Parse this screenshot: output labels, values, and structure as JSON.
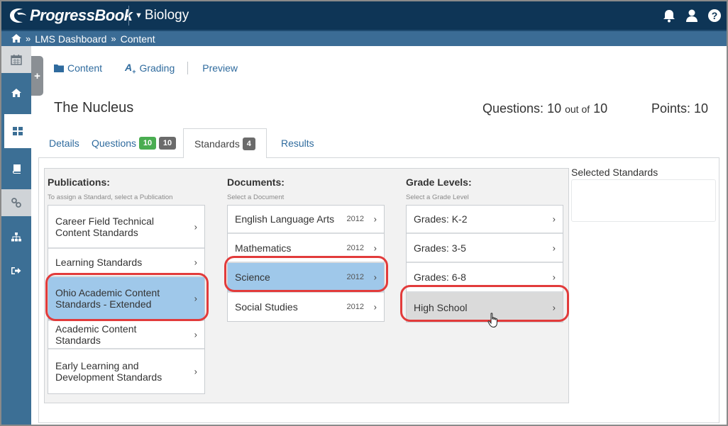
{
  "header": {
    "logo_text": "ProgressBook",
    "course_name": "Biology",
    "icons": [
      "bell-icon",
      "user-icon",
      "help-icon"
    ]
  },
  "breadcrumb": {
    "items": [
      "LMS Dashboard",
      "Content"
    ]
  },
  "leftnav": {
    "items": [
      "calendar-icon",
      "home-icon",
      "dashboard-icon",
      "book-icon",
      "link-icon",
      "sitemap-icon",
      "signout-icon"
    ]
  },
  "subnav": {
    "content": "Content",
    "grading": "Grading",
    "preview": "Preview"
  },
  "assessment": {
    "title": "The Nucleus",
    "questions_label": "Questions:",
    "questions_count": "10",
    "out_of": "out of",
    "questions_total": "10",
    "points_label": "Points:",
    "points_value": "10"
  },
  "tabs": {
    "details": "Details",
    "questions": "Questions",
    "questions_badge_green": "10",
    "questions_badge_gray": "10",
    "standards": "Standards",
    "standards_badge": "4",
    "results": "Results"
  },
  "publications": {
    "heading": "Publications:",
    "hint": "To assign a Standard, select a Publication",
    "items": [
      "Career Field Technical Content Standards",
      "Learning Standards",
      "Ohio Academic Content Standards - Extended",
      "Academic Content Standards",
      "Early Learning and Development Standards"
    ],
    "selected": "Ohio Academic Content Standards - Extended"
  },
  "documents": {
    "heading": "Documents:",
    "hint": "Select a Document",
    "items": [
      {
        "label": "English Language Arts",
        "year": "2012"
      },
      {
        "label": "Mathematics",
        "year": "2012"
      },
      {
        "label": "Science",
        "year": "2012"
      },
      {
        "label": "Social Studies",
        "year": "2012"
      }
    ],
    "selected": "Science"
  },
  "grade_levels": {
    "heading": "Grade Levels:",
    "hint": "Select a Grade Level",
    "items": [
      "Grades: K-2",
      "Grades: 3-5",
      "Grades: 6-8",
      "High School"
    ],
    "hovered": "High School"
  },
  "selected_standards": {
    "label": "Selected Standards"
  },
  "colors": {
    "header_bg": "#0e3556",
    "breadcrumb_bg": "#3b6c95",
    "link": "#2f6b9e",
    "selected_blue": "#9fc8ea",
    "hover_gray": "#dadada",
    "highlight_ring": "#e23b3b",
    "badge_green": "#4aad51",
    "badge_gray": "#6b6b6b"
  }
}
